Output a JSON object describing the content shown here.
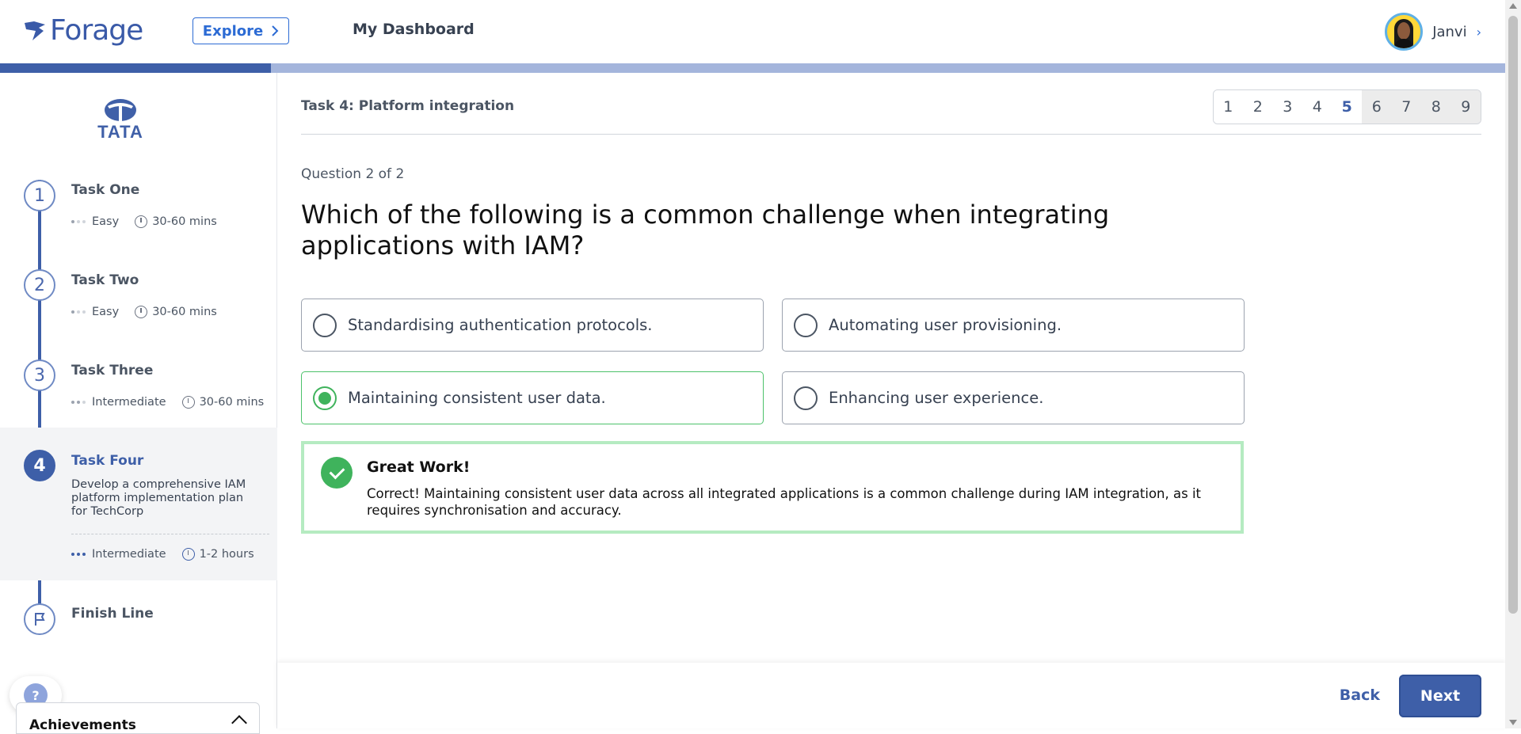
{
  "header": {
    "brand": "Forage",
    "explore_label": "Explore",
    "dashboard_label": "My Dashboard",
    "user_name": "Janvi"
  },
  "progress": {
    "fraction": 0.18
  },
  "sidebar": {
    "company_logo": "TATA",
    "tasks": [
      {
        "num": "1",
        "title": "Task One",
        "difficulty": "Easy",
        "duration": "30-60 mins"
      },
      {
        "num": "2",
        "title": "Task Two",
        "difficulty": "Easy",
        "duration": "30-60 mins"
      },
      {
        "num": "3",
        "title": "Task Three",
        "difficulty": "Intermediate",
        "duration": "30-60 mins"
      },
      {
        "num": "4",
        "title": "Task Four",
        "description": "Develop a comprehensive IAM platform implementation plan for TechCorp",
        "difficulty": "Intermediate",
        "duration": "1-2 hours"
      }
    ],
    "finish_label": "Finish Line",
    "help_label": "?",
    "achievements_label": "Achievements"
  },
  "main": {
    "task_header": "Task 4: Platform integration",
    "pager": [
      "1",
      "2",
      "3",
      "4",
      "5",
      "6",
      "7",
      "8",
      "9"
    ],
    "current_page": "5",
    "question_count": "Question 2 of 2",
    "question": "Which of the following is a common challenge when integrating applications with IAM?",
    "options": [
      "Standardising authentication protocols.",
      "Automating user provisioning.",
      "Maintaining consistent user data.",
      "Enhancing user experience."
    ],
    "selected_option": "Maintaining consistent user data.",
    "feedback_title": "Great Work!",
    "feedback_body": "Correct! Maintaining consistent user data across all integrated applications is a common challenge during IAM integration, as it requires synchronisation and accuracy."
  },
  "footer": {
    "back_label": "Back",
    "next_label": "Next"
  },
  "colors": {
    "brand": "#3e5fa8",
    "success": "#3fb35c",
    "success_border": "#b5ebc1",
    "link": "#2c6bd4"
  }
}
